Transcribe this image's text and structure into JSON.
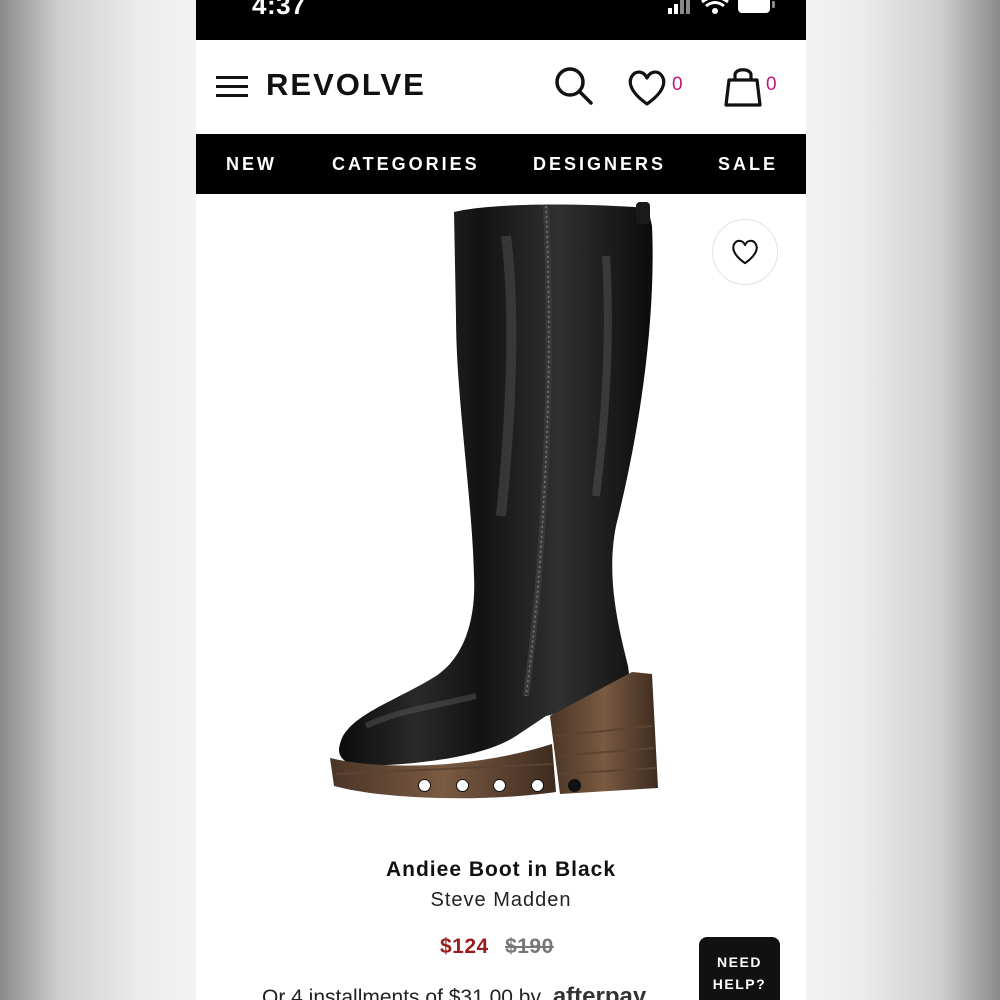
{
  "status_bar": {
    "time": "4:37"
  },
  "header": {
    "brand": "REVOLVE",
    "wishlist_count": "0",
    "bag_count": "0"
  },
  "nav": {
    "items": [
      "NEW",
      "CATEGORIES",
      "DESIGNERS",
      "SALE"
    ]
  },
  "carousel": {
    "slide_count": 5,
    "active_index": 4
  },
  "product": {
    "name": "Andiee Boot in Black",
    "designer": "Steve Madden",
    "sale_price": "$124",
    "original_price": "$190",
    "installment_text": "Or 4 installments of $31.00 by",
    "afterpay_label": "afterpay"
  },
  "help": {
    "line1": "NEED",
    "line2": "HELP?"
  },
  "colors": {
    "accent_count": "#c2187a",
    "sale_price": "#9b1c1c",
    "nav_background": "#000000"
  }
}
